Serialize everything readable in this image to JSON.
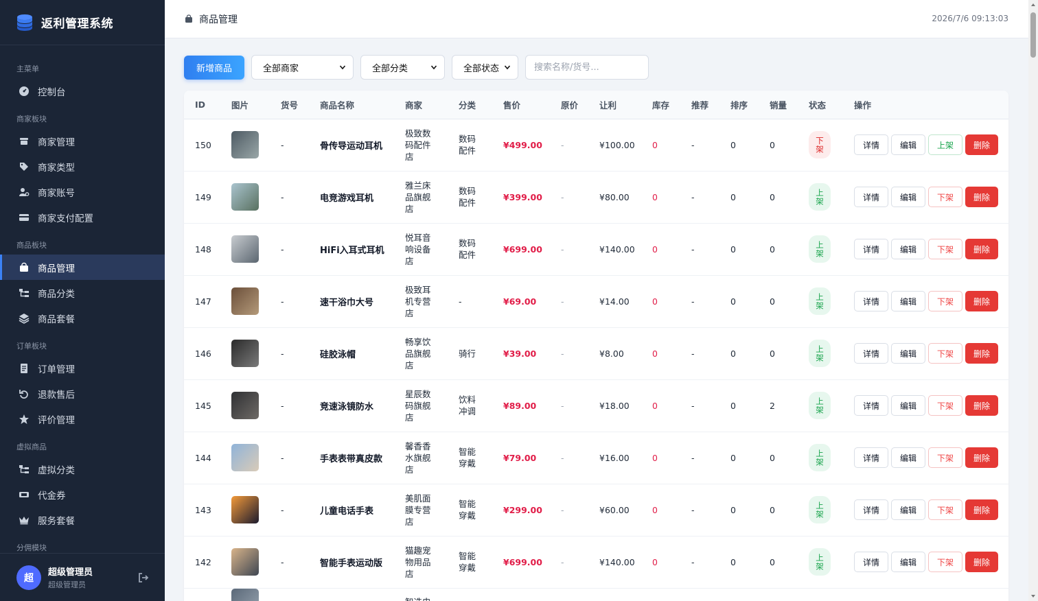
{
  "app": {
    "title": "返利管理系统"
  },
  "sidebar": {
    "sections": [
      {
        "label": "主菜单",
        "items": [
          {
            "label": "控制台",
            "icon": "dashboard-icon"
          }
        ]
      },
      {
        "label": "商家板块",
        "items": [
          {
            "label": "商家管理",
            "icon": "store-icon"
          },
          {
            "label": "商家类型",
            "icon": "tags-icon"
          },
          {
            "label": "商家账号",
            "icon": "user-gear-icon"
          },
          {
            "label": "商家支付配置",
            "icon": "credit-card-icon"
          }
        ]
      },
      {
        "label": "商品板块",
        "items": [
          {
            "label": "商品管理",
            "icon": "bag-icon",
            "active": true
          },
          {
            "label": "商品分类",
            "icon": "tree-icon"
          },
          {
            "label": "商品套餐",
            "icon": "layers-icon"
          }
        ]
      },
      {
        "label": "订单板块",
        "items": [
          {
            "label": "订单管理",
            "icon": "receipt-icon"
          },
          {
            "label": "退款售后",
            "icon": "undo-icon"
          },
          {
            "label": "评价管理",
            "icon": "star-icon"
          }
        ]
      },
      {
        "label": "虚拟商品",
        "items": [
          {
            "label": "虚拟分类",
            "icon": "tree-icon"
          },
          {
            "label": "代金券",
            "icon": "ticket-icon"
          },
          {
            "label": "服务套餐",
            "icon": "crown-icon"
          }
        ]
      },
      {
        "label": "分佣模块",
        "items": []
      }
    ]
  },
  "user": {
    "avatar": "超",
    "name": "超级管理员",
    "role": "超级管理员"
  },
  "header": {
    "title": "商品管理",
    "clock": "2026/7/6 09:13:03"
  },
  "toolbar": {
    "add_label": "新增商品",
    "merchant_select": "全部商家",
    "category_select": "全部分类",
    "status_select": "全部状态",
    "search_placeholder": "搜索名称/货号..."
  },
  "table": {
    "columns": [
      "ID",
      "图片",
      "货号",
      "商品名称",
      "商家",
      "分类",
      "售价",
      "原价",
      "让利",
      "库存",
      "推荐",
      "排序",
      "销量",
      "状态",
      "操作"
    ],
    "actions": {
      "detail": "详情",
      "edit": "编辑",
      "up": "上架",
      "down": "下架",
      "delete": "删除"
    },
    "rows": [
      {
        "id": "150",
        "img": [
          "#4d5a63",
          "#9aa7a8"
        ],
        "sku": "-",
        "name": "骨传导运动耳机",
        "merchant": "极致数码配件店",
        "category": "数码配件",
        "price": "¥499.00",
        "orig": "-",
        "rebate": "¥100.00",
        "stock": "0",
        "rec": "-",
        "sort": "0",
        "sales": "0",
        "status": "下架",
        "status_on": false
      },
      {
        "id": "149",
        "img": [
          "#aac4cf",
          "#58705f"
        ],
        "sku": "-",
        "name": "电竞游戏耳机",
        "merchant": "雅兰床品旗舰店",
        "category": "数码配件",
        "price": "¥399.00",
        "orig": "-",
        "rebate": "¥80.00",
        "stock": "0",
        "rec": "-",
        "sort": "0",
        "sales": "0",
        "status": "上架",
        "status_on": true
      },
      {
        "id": "148",
        "img": [
          "#c8ccd0",
          "#5b6670"
        ],
        "sku": "-",
        "name": "HiFi入耳式耳机",
        "merchant": "悦耳音响设备店",
        "category": "数码配件",
        "price": "¥699.00",
        "orig": "-",
        "rebate": "¥140.00",
        "stock": "0",
        "rec": "-",
        "sort": "0",
        "sales": "0",
        "status": "上架",
        "status_on": true
      },
      {
        "id": "147",
        "img": [
          "#6b4f3a",
          "#b49a7a"
        ],
        "sku": "-",
        "name": "速干浴巾大号",
        "merchant": "极致耳机专营店",
        "category": "-",
        "price": "¥69.00",
        "orig": "-",
        "rebate": "¥14.00",
        "stock": "0",
        "rec": "-",
        "sort": "0",
        "sales": "0",
        "status": "上架",
        "status_on": true
      },
      {
        "id": "146",
        "img": [
          "#2a2a2a",
          "#7a7a7a"
        ],
        "sku": "-",
        "name": "硅胶泳帽",
        "merchant": "畅享饮品旗舰店",
        "category": "骑行",
        "price": "¥39.00",
        "orig": "-",
        "rebate": "¥8.00",
        "stock": "0",
        "rec": "-",
        "sort": "0",
        "sales": "0",
        "status": "上架",
        "status_on": true
      },
      {
        "id": "145",
        "img": [
          "#2f3033",
          "#6e6a66"
        ],
        "sku": "-",
        "name": "竞速泳镜防水",
        "merchant": "星辰数码旗舰店",
        "category": "饮料冲调",
        "price": "¥89.00",
        "orig": "-",
        "rebate": "¥18.00",
        "stock": "0",
        "rec": "-",
        "sort": "0",
        "sales": "2",
        "status": "上架",
        "status_on": true
      },
      {
        "id": "144",
        "img": [
          "#8fb3d9",
          "#d9cbb8"
        ],
        "sku": "-",
        "name": "手表表带真皮款",
        "merchant": "馨香香水旗舰店",
        "category": "智能穿戴",
        "price": "¥79.00",
        "orig": "-",
        "rebate": "¥16.00",
        "stock": "0",
        "rec": "-",
        "sort": "0",
        "sales": "0",
        "status": "上架",
        "status_on": true
      },
      {
        "id": "143",
        "img": [
          "#f39a3a",
          "#1c1b2e"
        ],
        "sku": "-",
        "name": "儿童电话手表",
        "merchant": "美肌面膜专营店",
        "category": "智能穿戴",
        "price": "¥299.00",
        "orig": "-",
        "rebate": "¥60.00",
        "stock": "0",
        "rec": "-",
        "sort": "0",
        "sales": "0",
        "status": "上架",
        "status_on": true
      },
      {
        "id": "142",
        "img": [
          "#d9b48a",
          "#3e4652"
        ],
        "sku": "-",
        "name": "智能手表运动版",
        "merchant": "猫趣宠物用品店",
        "category": "智能穿戴",
        "price": "¥699.00",
        "orig": "-",
        "rebate": "¥140.00",
        "stock": "0",
        "rec": "-",
        "sort": "0",
        "sales": "0",
        "status": "上架",
        "status_on": true
      },
      {
        "id": "",
        "img": [
          "#5a6878",
          "#9aa6b2"
        ],
        "sku": "",
        "name": "",
        "merchant": "智选电",
        "category": "",
        "price": "",
        "orig": "",
        "rebate": "",
        "stock": "",
        "rec": "",
        "sort": "",
        "sales": "",
        "status": "",
        "status_on": true,
        "partial": true
      }
    ]
  },
  "colors": {
    "sidebar_bg": "#1b2536",
    "accent": "#3b82f6",
    "price": "#e11d48",
    "on": "#16a34a",
    "off": "#dc2626",
    "delete": "#e53935"
  }
}
